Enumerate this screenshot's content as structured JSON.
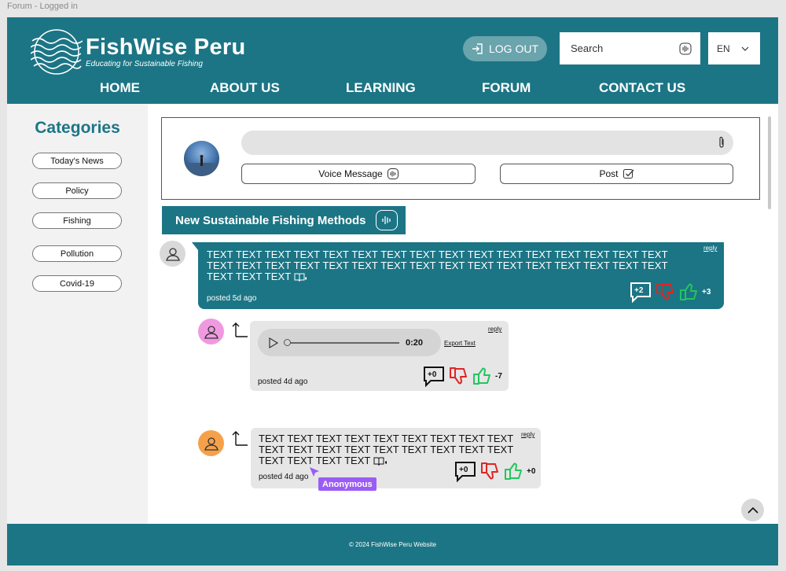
{
  "frame_label": "Forum - Logged in",
  "brand": {
    "title": "FishWise Peru",
    "tagline": "Educating for Sustainable Fishing"
  },
  "header": {
    "logout_label": "LOG OUT",
    "search_label": "Search",
    "language": "EN"
  },
  "nav": [
    "HOME",
    "ABOUT US",
    "LEARNING",
    "FORUM",
    "CONTACT US"
  ],
  "sidebar": {
    "title": "Categories",
    "categories": [
      "Today's News",
      "Policy",
      "Fishing",
      "Pollution",
      "Covid-19"
    ]
  },
  "composer": {
    "input_value": "",
    "voice_label": "Voice Message",
    "post_label": "Post"
  },
  "topic": {
    "title": "New Sustainable Fishing Methods"
  },
  "posts": [
    {
      "text": "TEXT TEXT TEXT TEXT TEXT TEXT TEXT TEXT TEXT TEXT TEXT TEXT TEXT TEXT TEXT TEXT TEXT TEXT TEXT TEXT TEXT TEXT TEXT TEXT TEXT TEXT TEXT TEXT TEXT TEXT TEXT TEXT TEXT TEXT TEXT",
      "posted": "posted 5d ago",
      "reply_label": "reply",
      "comments": "+2",
      "votes": "+3"
    },
    {
      "audio_time": "0:20",
      "export_label": "Export Text",
      "posted": "posted 4d ago",
      "reply_label": "reply",
      "comments": "+0",
      "votes": "-7"
    },
    {
      "text": "TEXT TEXT TEXT TEXT TEXT TEXT TEXT TEXT TEXT TEXT TEXT TEXT TEXT TEXT TEXT TEXT TEXT TEXT TEXT TEXT TEXT TEXT",
      "posted": "posted 4d ago",
      "reply_label": "reply",
      "comments": "+0",
      "votes": "+0"
    }
  ],
  "cursor_tag": "Anonymous",
  "footer": "© 2024 FishWise Peru Website",
  "colors": {
    "brand": "#1c7585",
    "dislike": "#e02424",
    "like": "#22c55e",
    "cursor": "#9b5cf5"
  }
}
